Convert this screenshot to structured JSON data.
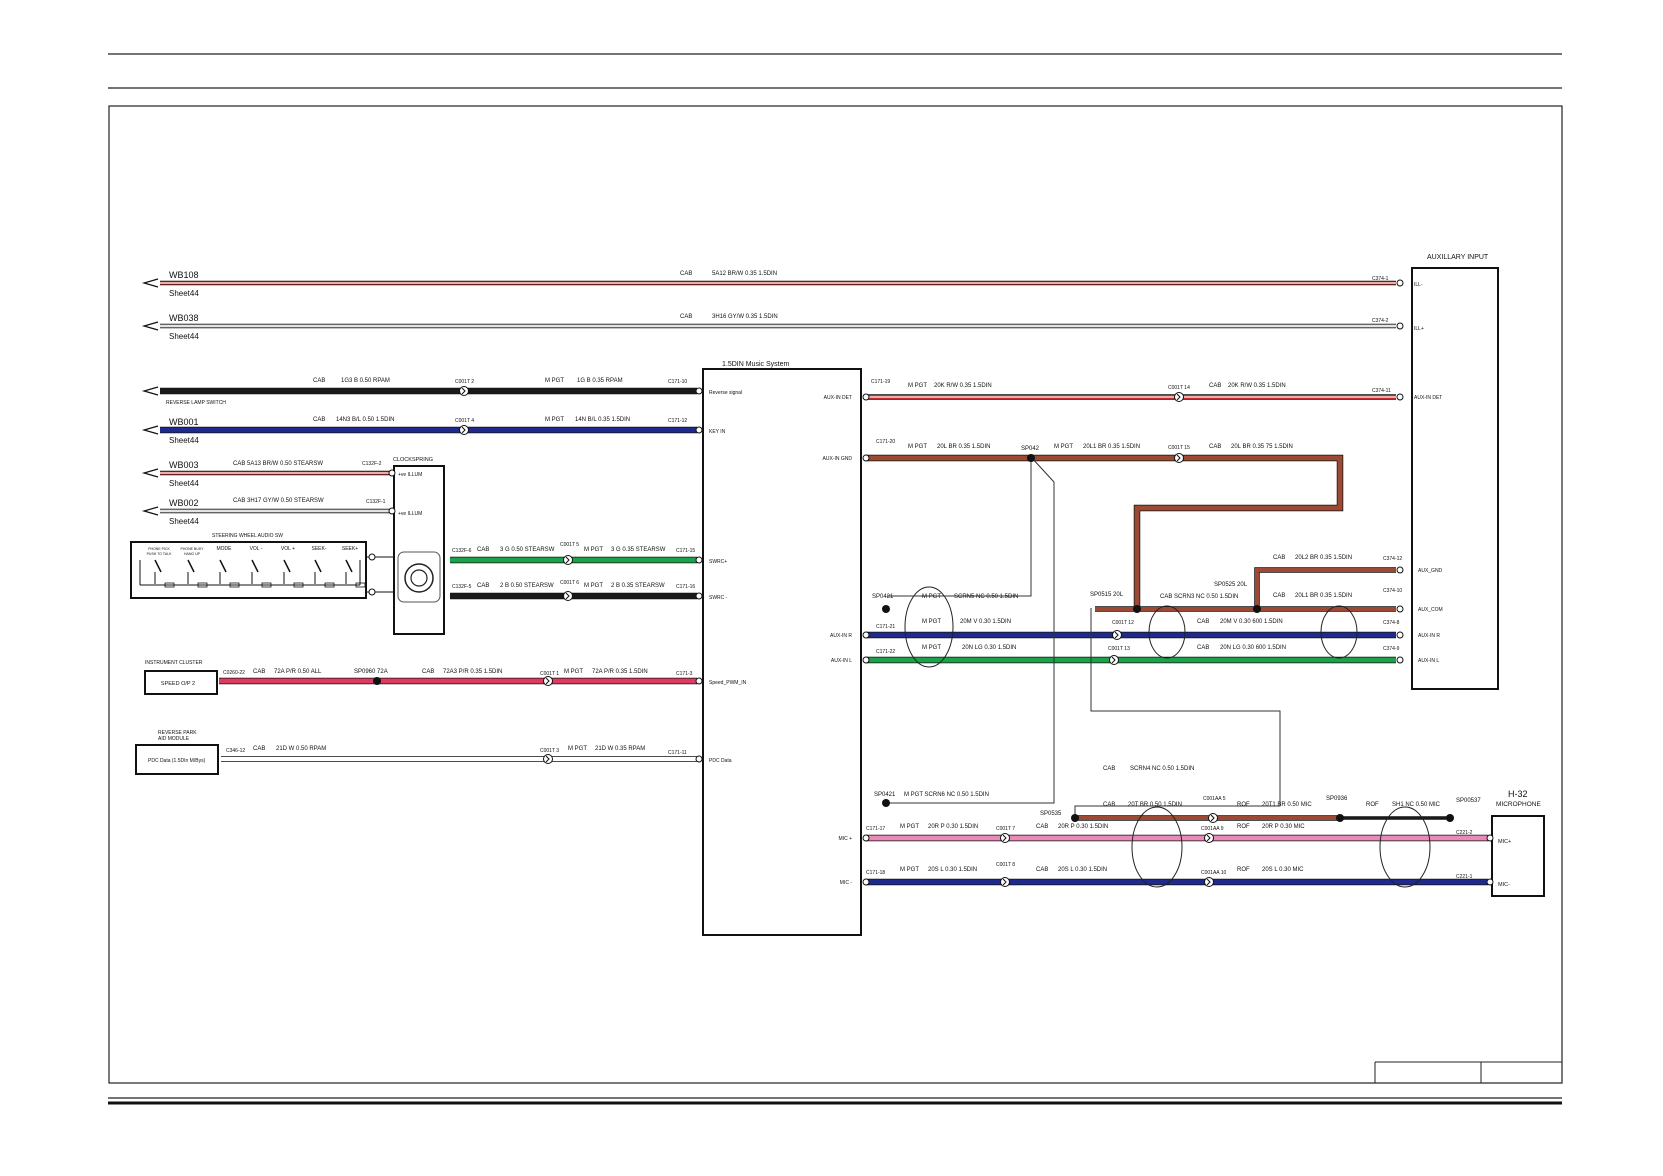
{
  "colors": {
    "brown": "#9c4a33",
    "red": "#c42a2a",
    "black": "#1a1a1a",
    "blue": "#1f2a8c",
    "green": "#1aa34a",
    "pink": "#e98ab8",
    "pinkred": "#e03a62",
    "grey": "#b8b8b8",
    "white_wire": "#ffffff"
  },
  "offsheet": [
    {
      "id": "WB108",
      "sheet": "Sheet44",
      "cab": "CAB",
      "wire": "5A12 BR/W 0.35 1.5DIN",
      "term": "C374-1",
      "color": "red"
    },
    {
      "id": "WB038",
      "sheet": "Sheet44",
      "cab": "CAB",
      "wire": "3H16 GY/W 0.35 1.5DIN",
      "term": "C374-2",
      "color": "grey"
    }
  ],
  "reverse": {
    "cab": "CAB",
    "wire1": "1G3 B 0.50 RPAM",
    "conn": "C001T 2",
    "mpgt": "M PGT",
    "wire2": "1G B 0.35 RPAM",
    "term": "C171-10",
    "label": "REVERSE LAMP SWITCH",
    "pin": "Reverse signal"
  },
  "wb001": {
    "id": "WB001",
    "sheet": "Sheet44",
    "cab": "CAB",
    "wire1": "14N3 B/L 0.50 1.5DIN",
    "conn": "C001T 4",
    "mpgt": "M PGT",
    "wire2": "14N B/L 0.35 1.5DIN",
    "term": "C171-12",
    "pin": "KEY IN"
  },
  "wb003": {
    "id": "WB003",
    "sheet": "Sheet44",
    "wire": "CAB   5A13 BR/W 0.50 STEARSW",
    "term": "C132F-2"
  },
  "wb002": {
    "id": "WB002",
    "sheet": "Sheet44",
    "wire": "CAB  3H17 GY/W 0.50 STEARSW",
    "term": "C132F-1"
  },
  "clockspring": {
    "title": "CLOCKSPRING",
    "pin1": "+ve ILLUM",
    "pin2": "+ve ILLUM"
  },
  "swa": {
    "title": "STEERING WHEEL AUDIO SW",
    "buttons": [
      "PHONE PICK\nPUSH TO TALK",
      "PHONE BUSY\nHANG UP",
      "MODE",
      "VOL -",
      "VOL +",
      "SEEK-",
      "SEEK+"
    ]
  },
  "swrc_plus": {
    "c1": "C132F-6",
    "cab": "CAB",
    "w1": "3 G 0.50 STEARSW",
    "conn": "C001T 5",
    "mpgt": "M PGT",
    "w2": "3 G 0.35 STEARSW",
    "term": "C171-15",
    "pin": "SWRC+"
  },
  "swrc_minus": {
    "c1": "C132F-5",
    "cab": "CAB",
    "w1": "2 B 0.50 STEARSW",
    "conn": "C001T 6",
    "mpgt": "M PGT",
    "w2": "2 B 0.35 STEARSW",
    "term": "C171-16",
    "pin": "SWRC -"
  },
  "speed": {
    "module": "INSTRUMENT CLUSTER",
    "box": "SPEED O/P 2",
    "c": "C0260-22",
    "cab": "CAB",
    "w1": "72A P/R 0.50 ALL",
    "sp": "SP0960 72A",
    "cab2": "CAB",
    "w2": "72A3 P/R 0.35 1.5DIN",
    "conn": "C001T 1",
    "mpgt": "M PGT",
    "w3": "72A P/R 0.35 1.5DIN",
    "term": "C171-3",
    "pin": "Speed_PWM_IN"
  },
  "pdc": {
    "module": "REVERSE PARK\nAID MODULE",
    "box": "PDC Data (1.5DIn M/Bys)",
    "c": "C346-12",
    "cab": "CAB",
    "w1": "21D W 0.50 RPAM",
    "conn": "C001T 3",
    "mpgt": "M PGT",
    "w2": "21D W 0.35 RPAM",
    "term": "C171-11",
    "pin": "PDC Data"
  },
  "music": {
    "title": "1.5DIN Music System",
    "right_pins": [
      "AUX-IN DET",
      "AUX-IN GND",
      "AUX-IN R",
      "AUX-IN L",
      "MIC +",
      "MIC -"
    ]
  },
  "aux": {
    "title": "AUXILLARY INPUT",
    "pins": [
      "ILL-",
      "ILL+",
      "AUX-IN DET",
      "AUX_GND",
      "AUX_COM",
      "AUX-IN R",
      "AUX-IN L"
    ]
  },
  "aux_det": {
    "c": "C171-19",
    "mpgt": "M PGT",
    "w1": "20K R/W 0.35 1.5DIN",
    "conn": "C001T 14",
    "cab": "CAB",
    "w2": "20K R/W 0.35 1.5DIN",
    "term": "C374-11"
  },
  "aux_gnd": {
    "c": "C171-20",
    "mpgt": "M PGT",
    "w1": "20L BR 0.35 1.5DIN",
    "sp": "SP042",
    "mpgt2": "M PGT",
    "w2": "20L1 BR 0.35 1.5DIN",
    "conn": "C001T 15",
    "cab": "CAB",
    "w3": "20L BR 0.35 75 1.5DIN"
  },
  "aux_right": {
    "sp0421": "SP0421",
    "mpgt": "M PGT",
    "scrn5": "SCRN5 NC 0.50 1.5DIN",
    "sp0515": "SP0515 20L",
    "cab_scrn3": "CAB SCRN3 NC 0.50 1.5DIN",
    "sp0525": "SP0525 20L",
    "cab_l2": "CAB",
    "w_l2": "20L2 BR 0.35 1.5DIN",
    "t_l2": "C374-12",
    "cab_l1": "CAB",
    "w_l1": "20L1 BR 0.35 1.5DIN",
    "t_l1": "C374-10",
    "r_c": "C171-21",
    "r_mpgt": "M PGT",
    "r_w": "20M V 0.30 1.5DIN",
    "r_conn": "C001T 12",
    "r_cab": "CAB",
    "r_w2": "20M V 0.30 600 1.5DIN",
    "r_term": "C374-8",
    "l_c": "C171-22",
    "l_mpgt": "M PGT",
    "l_w": "20N LG 0.30 1.5DIN",
    "l_conn": "C001T 13",
    "l_cab": "CAB",
    "l_w2": "20N LG 0.30 600 1.5DIN",
    "l_term": "C374-9"
  },
  "mic": {
    "sp0421b": "SP0421",
    "scrn6": "M PGT SCRN6 NC 0.50 1.5DIN",
    "cab_scrn4": "CAB",
    "scrn4": "SCRN4 NC 0.50 1.5DIN",
    "sp0535": "SP0535",
    "cab_t": "CAB",
    "w_t": "20T BR 0.50 1.5DIN",
    "c_aa5": "C001AA 5",
    "rof_t": "ROF",
    "w_t1": "20T1 BR 0.50 MIC",
    "sp0936": "SP0936",
    "rof_sh": "ROF",
    "w_sh": "SH1 NC 0.50 MIC",
    "sp00537": "SP00537",
    "p_c": "C171-17",
    "p_mpgt": "M PGT",
    "p_w": "20R P 0.30 1.5DIN",
    "p_conn": "C001T 7",
    "p_cab": "CAB",
    "p_w2": "20R P 0.30 1.5DIN",
    "p_aa": "C001AA 9",
    "p_rof": "ROF",
    "p_w3": "20R P 0.30 MIC",
    "p_term": "C221-2",
    "m_c": "C171-18",
    "m_mpgt": "M PGT",
    "m_w": "20S L 0.30 1.5DIN",
    "m_conn": "C001T 8",
    "m_cab": "CAB",
    "m_w2": "20S L 0.30 1.5DIN",
    "m_aa": "C001AA 10",
    "m_rof": "ROF",
    "m_w3": "20S L 0.30 MIC",
    "m_term": "C221-1",
    "h32": "H-32",
    "microphone": "MICROPHONE",
    "pin_plus": "MIC+",
    "pin_minus": "MIC-"
  }
}
